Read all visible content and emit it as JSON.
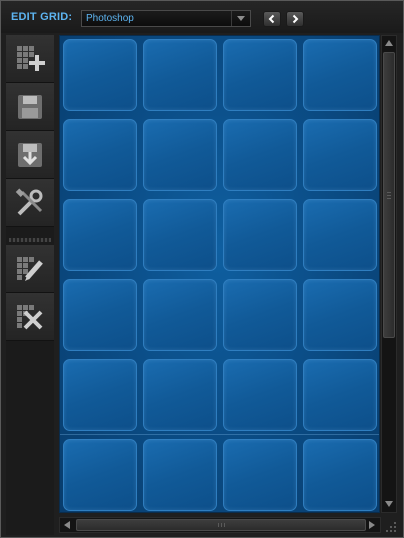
{
  "header": {
    "title": "EDIT GRID:",
    "grid_select": {
      "value": "Photoshop"
    },
    "prev_icon": "chevron-left-icon",
    "next_icon": "chevron-right-icon"
  },
  "toolbar": {
    "items": [
      {
        "name": "add-grid-button",
        "icon": "grid-add-icon"
      },
      {
        "name": "save-grid-button",
        "icon": "disk-save-icon"
      },
      {
        "name": "import-grid-button",
        "icon": "disk-import-icon"
      },
      {
        "name": "settings-button",
        "icon": "tools-icon"
      },
      {
        "name": "edit-grid-button",
        "icon": "grid-edit-icon"
      },
      {
        "name": "delete-grid-button",
        "icon": "grid-delete-icon"
      }
    ]
  },
  "grid": {
    "rows": 6,
    "columns": 4
  },
  "colors": {
    "accent": "#5db4f0",
    "grid_background": "#0b4e88",
    "cell": "#1a6cb0"
  }
}
